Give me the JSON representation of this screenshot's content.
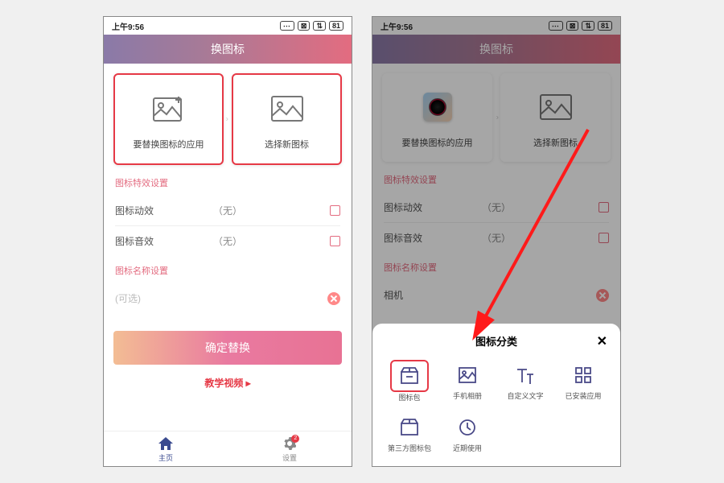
{
  "status": {
    "time": "上午9:56",
    "battery": "81"
  },
  "header": {
    "title": "换图标"
  },
  "cards": {
    "left": "要替换图标的应用",
    "right": "选择新图标"
  },
  "sections": {
    "effect_title": "图标特效设置",
    "anim_label": "图标动效",
    "anim_value": "（无）",
    "sound_label": "图标音效",
    "sound_value": "（无）",
    "name_title": "图标名称设置",
    "name_placeholder": "(可选)",
    "name_value": "相机"
  },
  "buttons": {
    "confirm": "确定替换",
    "tutorial": "教学视频 ▸"
  },
  "nav": {
    "home": "主页",
    "settings": "设置",
    "badge": "2"
  },
  "sheet": {
    "title": "图标分类",
    "items": [
      "图标包",
      "手机相册",
      "自定义文字",
      "已安装应用",
      "第三方图标包",
      "近期使用"
    ]
  }
}
